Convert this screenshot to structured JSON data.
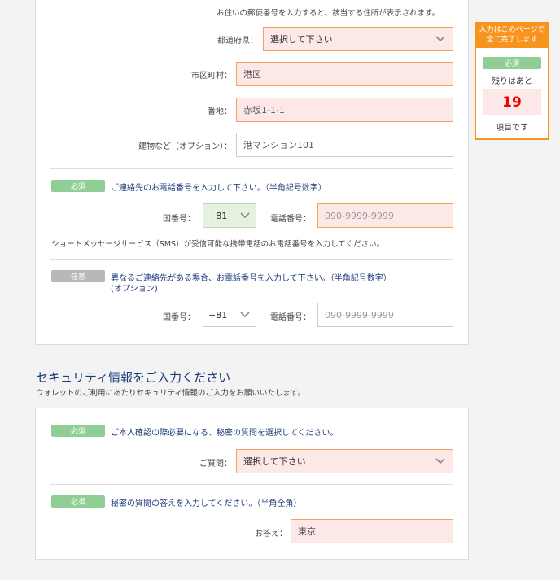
{
  "address": {
    "postal_note": "お住いの郵便番号を入力すると、該当する住所が表示されます。",
    "prefecture": {
      "label": "都道府県：",
      "value": "選択して下さい"
    },
    "city": {
      "label": "市区町村：",
      "value": "港区"
    },
    "street": {
      "label": "番地：",
      "value": "赤坂1-1-1"
    },
    "building": {
      "label": "建物など（オプション）：",
      "value": "港マンション101"
    }
  },
  "phone_primary": {
    "badge": "必須",
    "question": "ご連絡先のお電話番号を入力して下さい。（半角記号数字）",
    "country_label": "国番号：",
    "country_value": "+81",
    "phone_label": "電話番号：",
    "phone_placeholder": "090-9999-9999",
    "sms_note": "ショートメッセージサービス（SMS）が受信可能な携帯電話のお電話番号を入力してください。"
  },
  "phone_secondary": {
    "badge": "任意",
    "question": "異なるご連絡先がある場合、お電話番号を入力して下さい。（半角記号数字）",
    "question_sub": "(オプション)",
    "country_label": "国番号：",
    "country_value": "+81",
    "phone_label": "電話番号：",
    "phone_placeholder": "090-9999-9999"
  },
  "security": {
    "title": "セキュリティ情報をご入力ください",
    "subtitle": "ウォレットのご利用にあたりセキュリティ情報のご入力をお願いいたします。",
    "question_block": {
      "badge": "必須",
      "text": "ご本人確認の際必要になる、秘密の質問を選択してください。",
      "label": "ご質問：",
      "value": "選択して下さい"
    },
    "answer_block": {
      "badge": "必須",
      "text": "秘密の質問の答えを入力してください。（半角全角）",
      "label": "お答え：",
      "value": "東京"
    }
  },
  "progress": {
    "header": "入力はこのページで全て完了します",
    "badge": "必須",
    "remaining_label": "残りはあと",
    "count": "19",
    "unit": "項目です"
  },
  "colors": {
    "accent_orange": "#f7941d",
    "required_green": "#8fce94",
    "optional_gray": "#b8b8b8",
    "invalid_pink": "#fde8e8",
    "title_blue": "#1b3a78"
  }
}
